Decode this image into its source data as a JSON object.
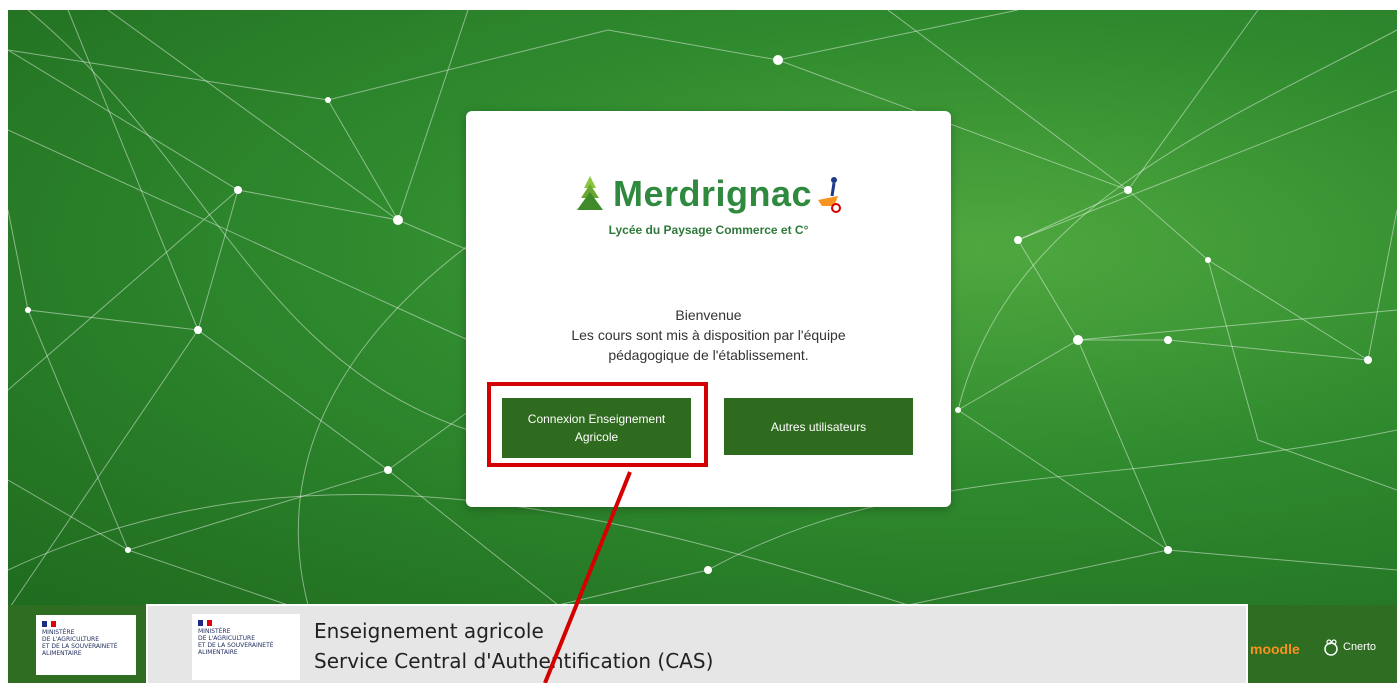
{
  "card": {
    "brand_name": "Merdrignac",
    "brand_subtitle": "Lycée du Paysage Commerce et C°",
    "welcome_title": "Bienvenue",
    "welcome_line1": "Les cours sont mis à disposition par l'équipe",
    "welcome_line2": "pédagogique de l'établissement.",
    "button_agri_line1": "Connexion Enseignement",
    "button_agri_line2": "Agricole",
    "button_other": "Autres utilisateurs"
  },
  "footer": {
    "ministry_lines": [
      "MINISTÈRE",
      "DE L'AGRICULTURE",
      "ET DE LA SOUVERAINETÉ",
      "ALIMENTAIRE"
    ],
    "moodle": "moodle",
    "cnerto": "Cnerto"
  },
  "cas_banner": {
    "line1": "Enseignement agricole",
    "line2": "Service Central d'Authentification (CAS)",
    "ministry_lines": [
      "MINISTÈRE",
      "DE L'AGRICULTURE",
      "ET DE LA SOUVERAINETÉ",
      "ALIMENTAIRE"
    ]
  },
  "colors": {
    "button": "#2f6b1f",
    "highlight": "#d40000",
    "brand": "#2f8a3f",
    "background": "#2f8a2e"
  }
}
